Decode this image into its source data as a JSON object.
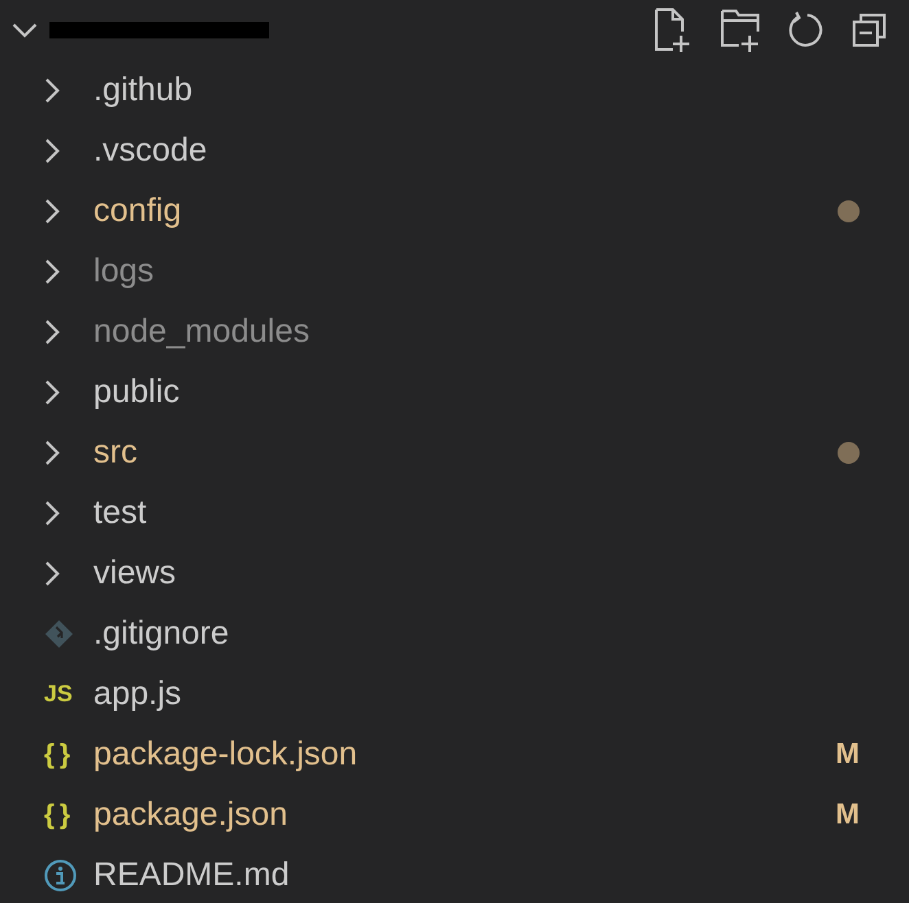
{
  "explorer": {
    "root": {
      "expanded": true,
      "redacted": true
    },
    "items": [
      {
        "kind": "folder",
        "name": ".github",
        "expanded": false,
        "modified": false,
        "ignored": false,
        "dot": false
      },
      {
        "kind": "folder",
        "name": ".vscode",
        "expanded": false,
        "modified": false,
        "ignored": false,
        "dot": false
      },
      {
        "kind": "folder",
        "name": "config",
        "expanded": false,
        "modified": true,
        "ignored": false,
        "dot": true
      },
      {
        "kind": "folder",
        "name": "logs",
        "expanded": false,
        "modified": false,
        "ignored": true,
        "dot": false
      },
      {
        "kind": "folder",
        "name": "node_modules",
        "expanded": false,
        "modified": false,
        "ignored": true,
        "dot": false
      },
      {
        "kind": "folder",
        "name": "public",
        "expanded": false,
        "modified": false,
        "ignored": false,
        "dot": false
      },
      {
        "kind": "folder",
        "name": "src",
        "expanded": false,
        "modified": true,
        "ignored": false,
        "dot": true
      },
      {
        "kind": "folder",
        "name": "test",
        "expanded": false,
        "modified": false,
        "ignored": false,
        "dot": false
      },
      {
        "kind": "folder",
        "name": "views",
        "expanded": false,
        "modified": false,
        "ignored": false,
        "dot": false
      },
      {
        "kind": "git",
        "name": ".gitignore",
        "modified": false,
        "ignored": false
      },
      {
        "kind": "js",
        "name": "app.js",
        "icon_text": "JS",
        "modified": false,
        "ignored": false
      },
      {
        "kind": "json",
        "name": "package-lock.json",
        "icon_text": "{ }",
        "modified": true,
        "ignored": false,
        "badge": "M"
      },
      {
        "kind": "json",
        "name": "package.json",
        "icon_text": "{ }",
        "modified": true,
        "ignored": false,
        "badge": "M"
      },
      {
        "kind": "info",
        "name": "README.md",
        "modified": false,
        "ignored": false
      }
    ]
  }
}
